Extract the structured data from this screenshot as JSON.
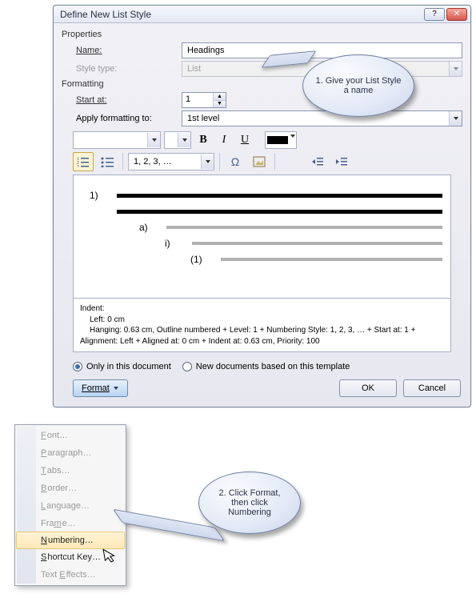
{
  "title": "Define New List Style",
  "winbuttons": {
    "help": "?",
    "close": "✕"
  },
  "properties": {
    "section": "Properties",
    "name_label": "Name:",
    "name_value": "Headings",
    "styletype_label": "Style type:",
    "styletype_value": "List"
  },
  "formatting": {
    "section": "Formatting",
    "startat_label": "Start at:",
    "startat_value": "1",
    "applyto_label": "Apply formatting to:",
    "applyto_value": "1st level",
    "font_name": "",
    "font_size": "",
    "bold": "B",
    "italic": "I",
    "underline": "U",
    "numformat": "1, 2, 3, …",
    "omega": "Ω"
  },
  "preview": {
    "l1": "1)",
    "l2": "a)",
    "l3": "i)",
    "l4": "(1)"
  },
  "description": {
    "indent_label": "Indent:",
    "left": "Left:  0 cm",
    "hanging": "Hanging:  0.63 cm, Outline numbered + Level: 1 + Numbering Style: 1, 2, 3, … + Start at: 1 +",
    "align": "Alignment: Left + Aligned at:  0 cm + Indent at:  0.63 cm, Priority: 100"
  },
  "radio": {
    "only": "Only in this document",
    "newdocs": "New documents based on this template"
  },
  "buttons": {
    "format": "Format",
    "ok": "OK",
    "cancel": "Cancel"
  },
  "callouts": {
    "c1": "1. Give your List Style a name",
    "c2": "2. Click Format, then click Numbering"
  },
  "menu": {
    "font": "Font…",
    "paragraph": "Paragraph…",
    "tabs": "Tabs…",
    "border": "Border…",
    "language": "Language…",
    "frame": "Frame…",
    "numbering": "Numbering…",
    "shortcut": "Shortcut Key…",
    "texteffects": "Text Effects…"
  }
}
